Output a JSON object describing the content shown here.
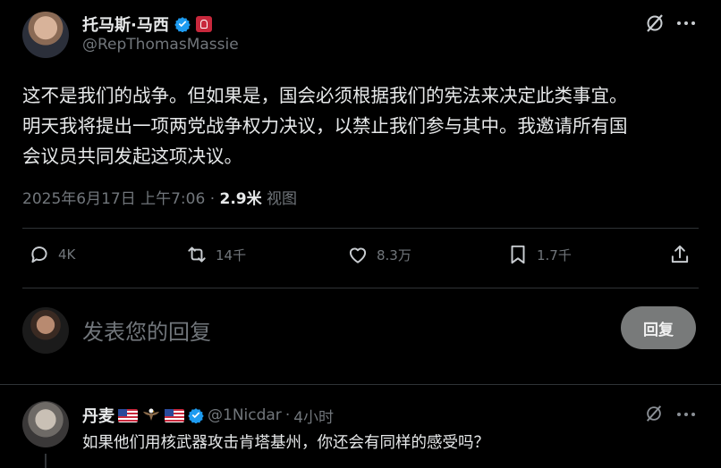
{
  "tweet": {
    "author_name": "托马斯·马西",
    "author_handle": "@RepThomasMassie",
    "text_line1": "这不是我们的战争。但如果是，国会必须根据我们的宪法来决定此类事宜。",
    "text_line2": "明天我将提出一项两党战争权力决议，以禁止我们参与其中。我邀请所有国",
    "text_line3": "会议员共同发起这项决议。",
    "timestamp": "2025年6月17日 上午7:06",
    "separator": " · ",
    "views_count": "2.9米",
    "views_label": " 视图"
  },
  "actions": {
    "replies": "4K",
    "reposts": "14千",
    "likes": "8.3万",
    "bookmarks": "1.7千"
  },
  "reply_box": {
    "placeholder": "发表您的回复",
    "button_label": "回复"
  },
  "reply": {
    "author_name": "丹麦",
    "author_handle": "@1Nicdar",
    "separator": " · ",
    "time": "4小时",
    "text": "如果他们用核武器攻击肯塔基州，你还会有同样的感受吗？"
  },
  "colors": {
    "background": "#000000",
    "verified_badge": "#1d9bf0",
    "muted_text": "#71767b",
    "reply_button": "#787a7a"
  },
  "icons": [
    "grok-icon",
    "more-icon",
    "verified-badge-icon",
    "government-flag-icon",
    "reply-icon",
    "repost-icon",
    "like-icon",
    "bookmark-icon",
    "share-icon",
    "us-flag-icon",
    "eagle-icon"
  ]
}
